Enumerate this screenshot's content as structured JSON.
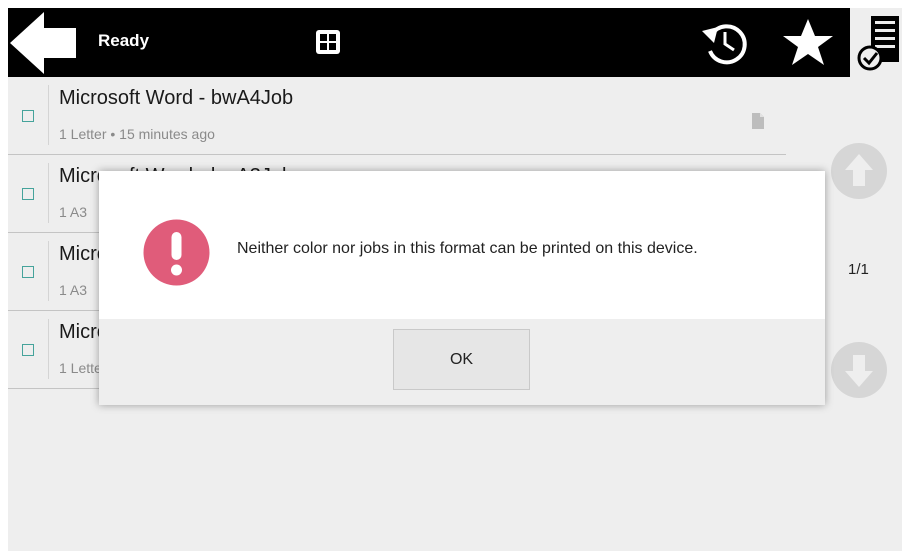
{
  "header": {
    "status": "Ready"
  },
  "jobs": [
    {
      "title": "Microsoft Word - bwA4Job",
      "meta": "1 Letter • 15 minutes ago"
    },
    {
      "title": "Microsoft Word - bwA3Job",
      "meta": "1 A3"
    },
    {
      "title": "Microsoft Word",
      "meta": "1 A3"
    },
    {
      "title": "Microsoft Word",
      "meta": "1 Letter"
    }
  ],
  "pager": {
    "label": "1/1"
  },
  "dialog": {
    "message": "Neither color nor jobs in this format can be printed on this device.",
    "ok_label": "OK"
  },
  "colors": {
    "header_bg": "#000000",
    "alert_accent": "#e05c7a",
    "checkbox_accent": "#45a39b",
    "background": "#eeeeee"
  },
  "icons": [
    "back-arrow-icon",
    "grid-icon",
    "history-icon",
    "star-icon",
    "print-jobs-icon",
    "document-icon",
    "arrow-up-icon",
    "arrow-down-icon",
    "exclamation-icon"
  ]
}
